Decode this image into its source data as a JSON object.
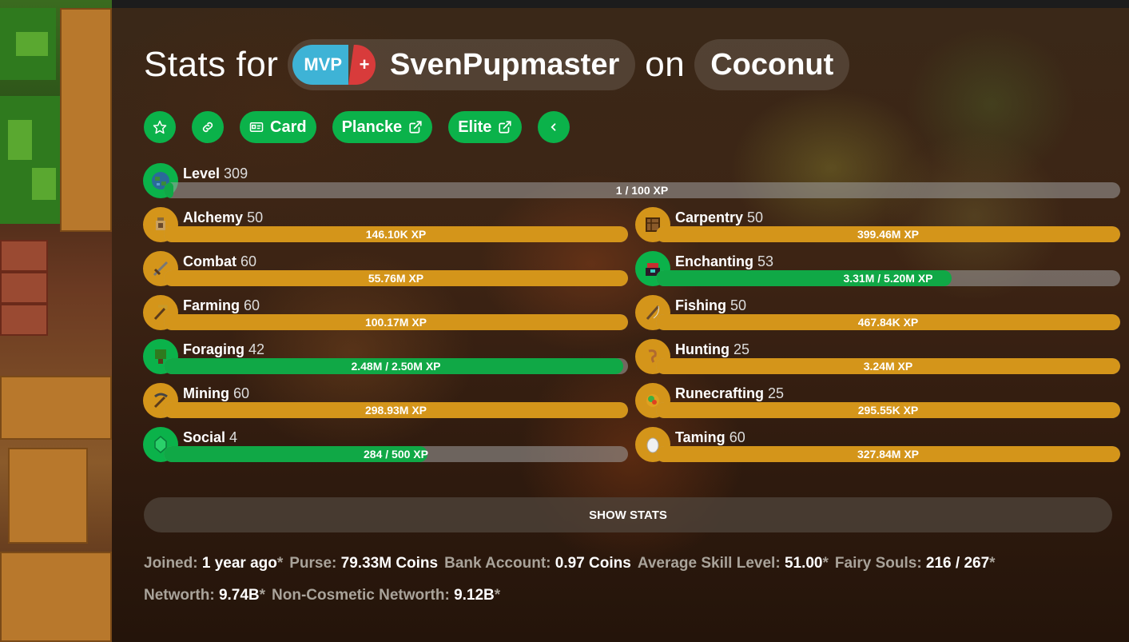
{
  "header": {
    "prefix": "Stats for",
    "rank_main": "MVP",
    "rank_plus": "+",
    "player": "SvenPupmaster",
    "connector": "on",
    "profile": "Coconut"
  },
  "buttons": {
    "card": "Card",
    "plancke": "Plancke",
    "elite": "Elite"
  },
  "level": {
    "name": "Level",
    "value": "309",
    "xp": "1 / 100 XP",
    "progress": 0.01
  },
  "skills_left": [
    {
      "name": "Alchemy",
      "level": "50",
      "xp": "146.10K XP",
      "progress": 1.0,
      "maxed": true
    },
    {
      "name": "Combat",
      "level": "60",
      "xp": "55.76M XP",
      "progress": 1.0,
      "maxed": true
    },
    {
      "name": "Farming",
      "level": "60",
      "xp": "100.17M XP",
      "progress": 1.0,
      "maxed": true
    },
    {
      "name": "Foraging",
      "level": "42",
      "xp": "2.48M / 2.50M XP",
      "progress": 0.99,
      "maxed": false
    },
    {
      "name": "Mining",
      "level": "60",
      "xp": "298.93M XP",
      "progress": 1.0,
      "maxed": true
    },
    {
      "name": "Social",
      "level": "4",
      "xp": "284 / 500 XP",
      "progress": 0.568,
      "maxed": false
    }
  ],
  "skills_right": [
    {
      "name": "Carpentry",
      "level": "50",
      "xp": "399.46M XP",
      "progress": 1.0,
      "maxed": true
    },
    {
      "name": "Enchanting",
      "level": "53",
      "xp": "3.31M / 5.20M XP",
      "progress": 0.637,
      "maxed": false
    },
    {
      "name": "Fishing",
      "level": "50",
      "xp": "467.84K XP",
      "progress": 1.0,
      "maxed": true
    },
    {
      "name": "Hunting",
      "level": "25",
      "xp": "3.24M XP",
      "progress": 1.0,
      "maxed": true
    },
    {
      "name": "Runecrafting",
      "level": "25",
      "xp": "295.55K XP",
      "progress": 1.0,
      "maxed": true
    },
    {
      "name": "Taming",
      "level": "60",
      "xp": "327.84M XP",
      "progress": 1.0,
      "maxed": true
    }
  ],
  "show_stats": "SHOW STATS",
  "info": {
    "joined_k": "Joined:",
    "joined_v": "1 year ago",
    "purse_k": "Purse:",
    "purse_v": "79.33M Coins",
    "bank_k": "Bank Account:",
    "bank_v": "0.97 Coins",
    "avg_k": "Average Skill Level:",
    "avg_v": "51.00",
    "fairy_k": "Fairy Souls:",
    "fairy_v": "216 / 267",
    "networth_k": "Networth:",
    "networth_v": "9.74B",
    "noncos_k": "Non-Cosmetic Networth:",
    "noncos_v": "9.12B",
    "asterisk": "*"
  },
  "colors": {
    "accent_green": "#0bb24a",
    "maxed_gold": "#d4951a",
    "rank_blue": "#3eb3d6",
    "rank_red": "#d83b3b"
  }
}
